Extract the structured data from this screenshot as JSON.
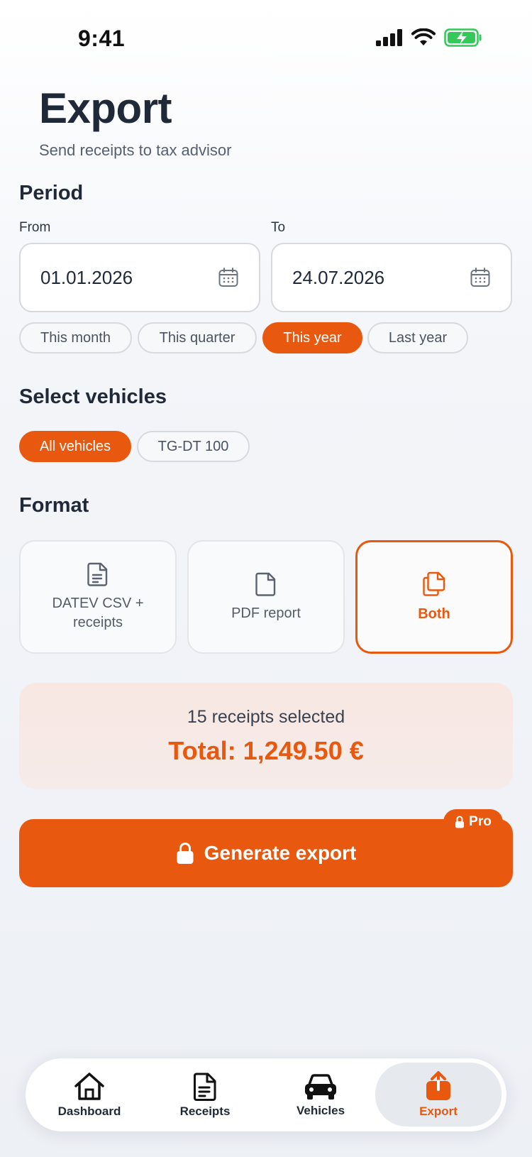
{
  "status_bar": {
    "time": "9:41"
  },
  "header": {
    "title": "Export",
    "subtitle": "Send receipts to tax advisor"
  },
  "period": {
    "title": "Period",
    "from_label": "From",
    "to_label": "To",
    "from_value": "01.01.2026",
    "to_value": "24.07.2026",
    "presets": [
      "This month",
      "This quarter",
      "This year",
      "Last year"
    ],
    "selected_preset": "This year"
  },
  "vehicles": {
    "title": "Select vehicles",
    "options": [
      "All vehicles",
      "TG-DT 100"
    ],
    "selected": "All vehicles"
  },
  "format": {
    "title": "Format",
    "options": [
      "DATEV CSV + receipts",
      "PDF report",
      "Both"
    ],
    "selected": "Both"
  },
  "summary": {
    "count_text": "15 receipts selected",
    "total_text": "Total: 1,249.50 €"
  },
  "generate": {
    "label": "Generate export",
    "badge": "Pro"
  },
  "tabs": [
    {
      "label": "Dashboard",
      "icon": "home-icon"
    },
    {
      "label": "Receipts",
      "icon": "document-icon"
    },
    {
      "label": "Vehicles",
      "icon": "car-icon"
    },
    {
      "label": "Export",
      "icon": "export-icon"
    }
  ],
  "active_tab": "Export",
  "colors": {
    "accent": "#e8590f",
    "text": "#1f2937",
    "battery": "#34c759"
  }
}
